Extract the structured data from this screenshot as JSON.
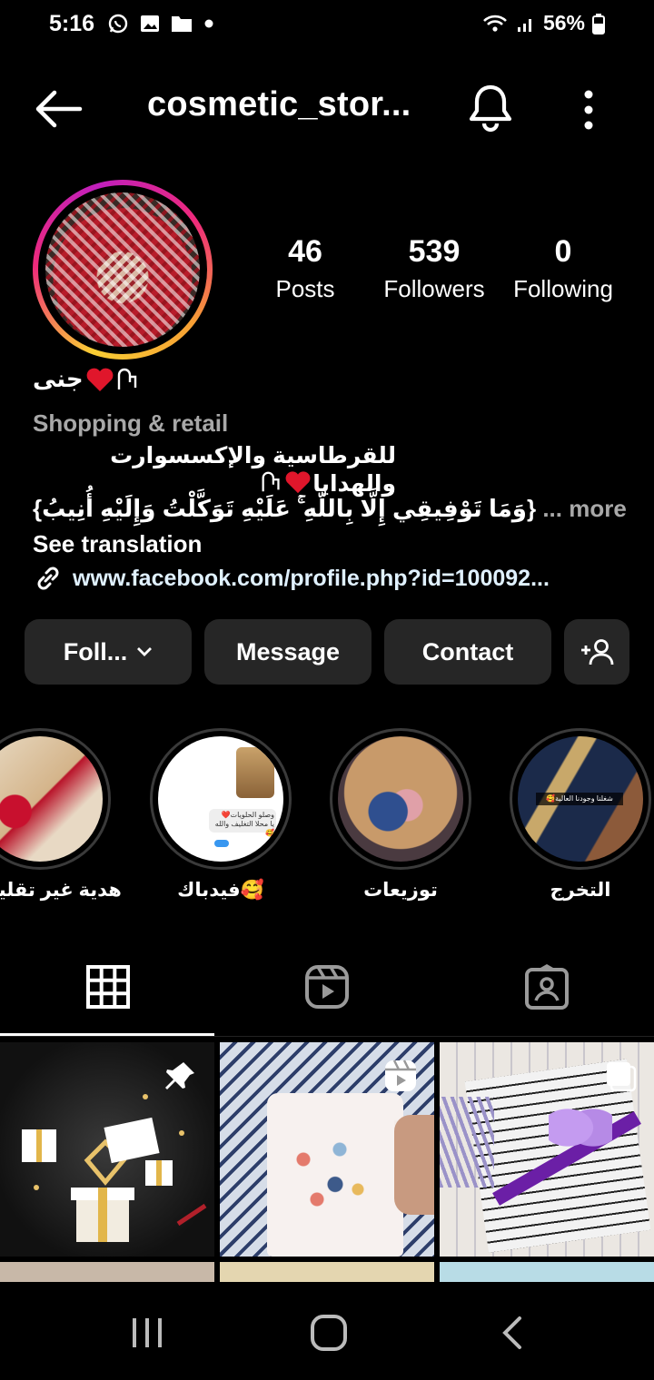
{
  "status_bar": {
    "time": "5:16",
    "battery": "56%"
  },
  "header": {
    "username": "cosmetic_stor..."
  },
  "stats": [
    {
      "value": "46",
      "label": "Posts"
    },
    {
      "value": "539",
      "label": "Followers"
    },
    {
      "value": "0",
      "label": "Following"
    }
  ],
  "profile": {
    "name": "جنى",
    "category": "Shopping & retail",
    "bio_line1": "للقرطاسية والإكسسوارت والهدايا",
    "bio_line2": "{وَمَا تَوْفِيقِي إِلَّا بِاللَّهِ ۚ عَلَيْهِ تَوَكَّلْتُ وَإِلَيْهِ أُنِيبُ}",
    "more_label": "... more",
    "see_translation": "See translation",
    "link": "www.facebook.com/profile.php?id=100092..."
  },
  "buttons": {
    "follow": "Foll...",
    "message": "Message",
    "contact": "Contact"
  },
  "highlights": [
    {
      "label": "هدية غير تقليدية"
    },
    {
      "label": "فيدباك🥰"
    },
    {
      "label": "توزيعات"
    },
    {
      "label": "التخرج"
    }
  ],
  "highlight_texts": {
    "feedback_chat": "وصلو الحلويات❤️",
    "feedback_chat2": "يا محلا التغليف والله🥰",
    "graduation_caption": "شغلنا وجودنا العالية🥰"
  },
  "icons": {
    "back": "arrow-left-icon",
    "bell": "bell-icon",
    "more": "more-vertical-icon",
    "add_person": "add-person-icon",
    "grid": "grid-icon",
    "reels": "reels-icon",
    "tagged": "tagged-icon",
    "link": "link-icon",
    "pin": "pin-icon"
  },
  "colors": {
    "background": "#000000",
    "button": "#262626",
    "secondary_text": "#a8a8a8"
  }
}
